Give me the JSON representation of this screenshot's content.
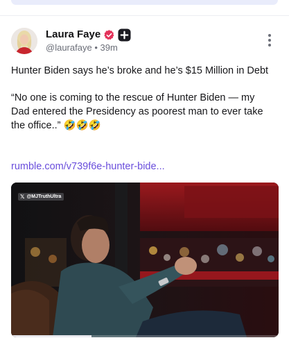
{
  "post": {
    "author": {
      "display_name": "Laura Faye",
      "handle": "@laurafaye",
      "separator": "•",
      "time_ago": "39m",
      "verified_badge": "verified-check-icon",
      "extra_badge": "plus-badge-icon"
    },
    "body": {
      "line1": "Hunter Biden says he’s broke and he’s $15 Million in Debt",
      "line2": "“No one is coming to the rescue of Hunter Biden — my Dad entered the Presidency as poorest man to ever take the office..”",
      "emojis": "🤣🤣🤣"
    },
    "link_text": "rumble.com/v739f6e-hunter-bide...",
    "media": {
      "watermark": "@MJTruthUltra",
      "watermark_icon": "x-logo-icon",
      "progress": 0.3
    },
    "menu_icon": "more-vertical-icon"
  },
  "colors": {
    "accent_link": "#6a4edc",
    "verified": "#e3335b",
    "muted_text": "#6b6e78"
  }
}
